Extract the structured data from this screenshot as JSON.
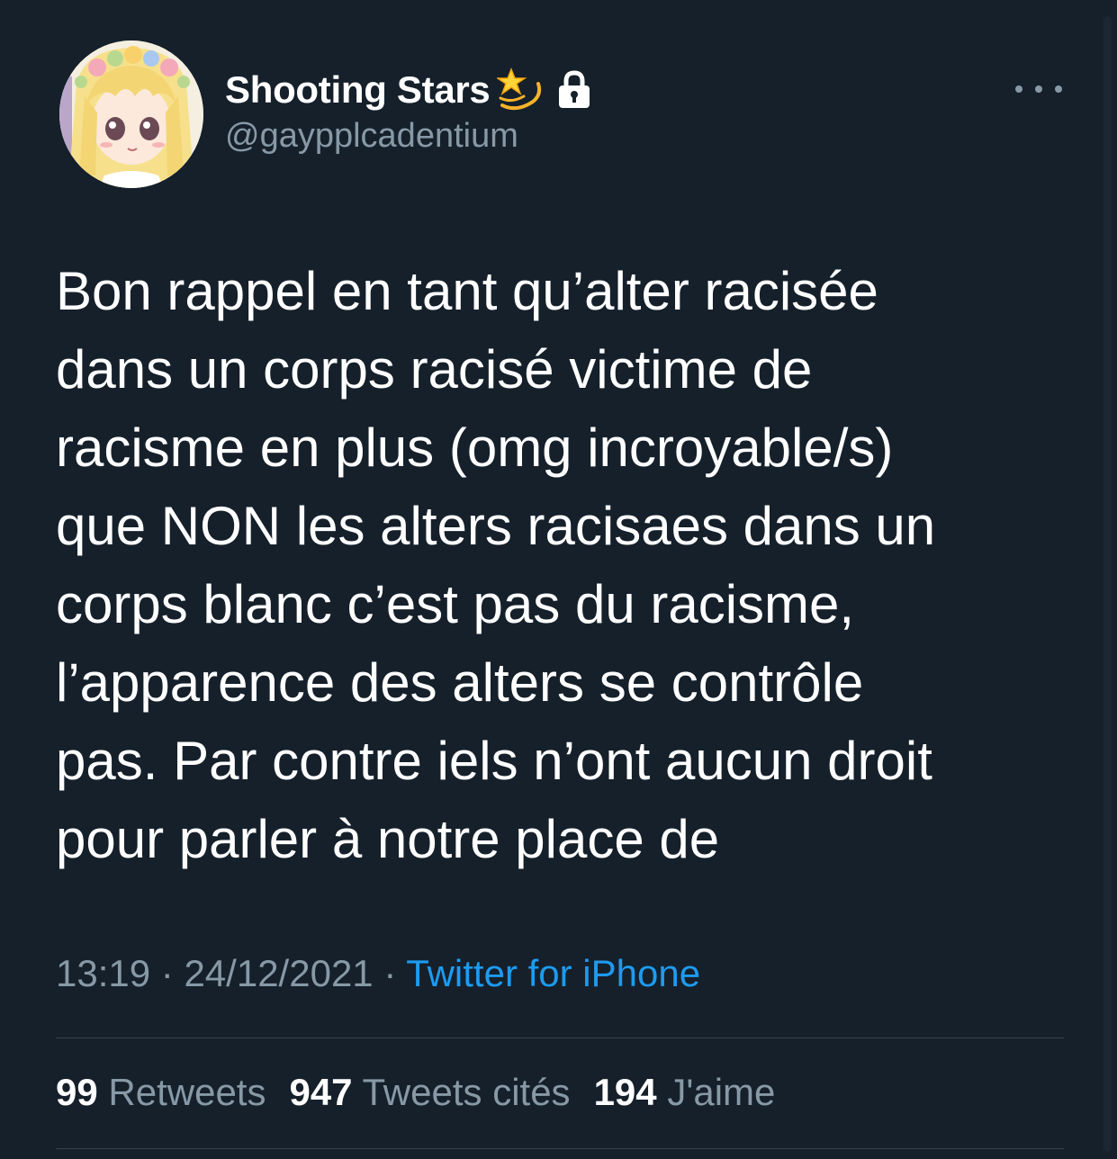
{
  "tweet": {
    "author": {
      "display_name": "Shooting Stars",
      "handle": "@gaypplcadentium",
      "name_emoji_icon": "dizzy-star-emoji-icon",
      "protected_icon": "lock-icon"
    },
    "more_icon": "more-horizontal-icon",
    "text_lines": [
      "Bon rappel en tant qu’alter racisée",
      "dans un corps racisé victime de",
      "racisme en plus (omg incroyable/s)",
      "que NON les alters racisaes dans un",
      "corps blanc c’est pas du racisme,",
      "l’apparence des alters se contrôle",
      "pas. Par contre iels n’ont aucun droit",
      "pour parler à notre place de"
    ],
    "time": "13:19",
    "separator": "·",
    "date": "24/12/2021",
    "source": "Twitter for iPhone",
    "stats": {
      "retweets_count": "99",
      "retweets_label": "Retweets",
      "quotes_count": "947",
      "quotes_label": "Tweets cités",
      "likes_count": "194",
      "likes_label": "J'aime"
    }
  },
  "colors": {
    "background": "#15202b",
    "text_primary": "#ffffff",
    "text_secondary": "#8899a6",
    "link": "#1d9bf0",
    "divider": "#38444d"
  }
}
